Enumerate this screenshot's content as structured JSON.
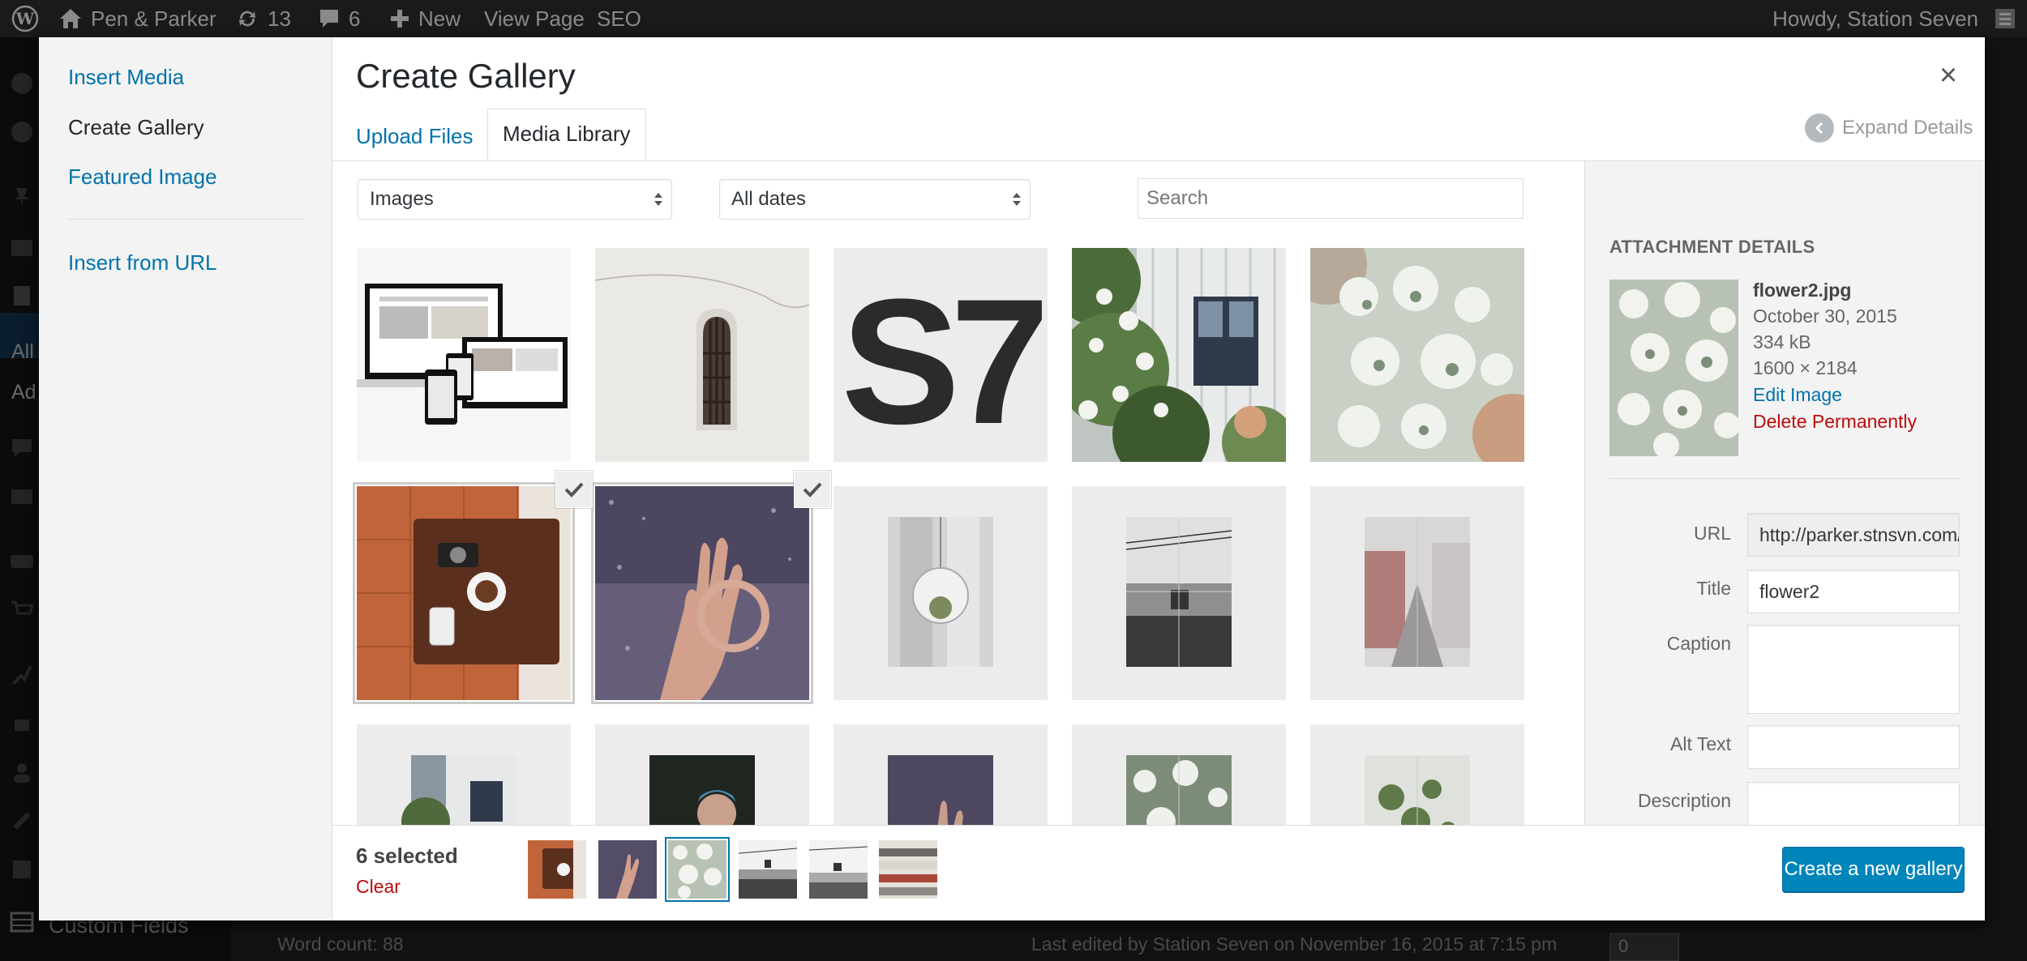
{
  "admin_bar": {
    "site_name": "Pen & Parker",
    "updates_count": "13",
    "comments_count": "6",
    "new_label": "New",
    "view_page_label": "View Page",
    "seo_label": "SEO",
    "greeting": "Howdy, Station Seven"
  },
  "background": {
    "menu_all": "All",
    "menu_add": "Ad",
    "custom_fields": "Custom Fields",
    "word_count": "Word count: 88",
    "last_edited": "Last edited by Station Seven on November 16, 2015 at 7:15 pm",
    "field_value": "0"
  },
  "media_menu": {
    "items": [
      {
        "label": "Insert Media",
        "active": false
      },
      {
        "label": "Create Gallery",
        "active": true
      },
      {
        "label": "Featured Image",
        "active": false
      },
      {
        "label": "Insert from URL",
        "active": false
      }
    ]
  },
  "frame": {
    "title": "Create Gallery",
    "close_symbol": "×",
    "tabs": [
      {
        "label": "Upload Files",
        "active": false
      },
      {
        "label": "Media Library",
        "active": true
      }
    ],
    "expand_details": "Expand Details"
  },
  "filters": {
    "type_selected": "Images",
    "date_selected": "All dates",
    "search_placeholder": "Search"
  },
  "grid": {
    "items": [
      {
        "name": "devices-mockup",
        "selected": false
      },
      {
        "name": "arched-window",
        "selected": false
      },
      {
        "name": "s7-logo",
        "selected": false,
        "text": "S7"
      },
      {
        "name": "house-with-flowers",
        "selected": false
      },
      {
        "name": "white-flowers",
        "selected": false
      },
      {
        "name": "coffee-table",
        "selected": true
      },
      {
        "name": "hand-on-glass",
        "selected": true
      },
      {
        "name": "poster-terrarium",
        "selected": false
      },
      {
        "name": "poster-cable-car",
        "selected": false
      },
      {
        "name": "poster-street",
        "selected": false
      },
      {
        "name": "poster-house",
        "selected": false
      },
      {
        "name": "poster-portrait",
        "selected": false
      },
      {
        "name": "poster-hand",
        "selected": false
      },
      {
        "name": "poster-flowers",
        "selected": false
      },
      {
        "name": "poster-plants",
        "selected": false
      }
    ]
  },
  "attachment_details": {
    "heading": "ATTACHMENT DETAILS",
    "filename": "flower2.jpg",
    "date": "October 30, 2015",
    "filesize": "334 kB",
    "dimensions": "1600 × 2184",
    "edit_link": "Edit Image",
    "delete_link": "Delete Permanently",
    "fields": {
      "url_label": "URL",
      "url_value": "http://parker.stnsvn.com/wp",
      "title_label": "Title",
      "title_value": "flower2",
      "caption_label": "Caption",
      "caption_value": "",
      "alt_label": "Alt Text",
      "alt_value": "",
      "description_label": "Description",
      "description_value": ""
    }
  },
  "selection": {
    "count_label": "6 selected",
    "clear_label": "Clear",
    "thumbs": [
      "coffee-table",
      "hand-on-glass",
      "white-flowers",
      "cable-car-1",
      "cable-car-2",
      "wood-planks"
    ]
  },
  "primary_button": "Create a new gallery",
  "colors": {
    "link": "#0073aa",
    "danger": "#bc0b0b",
    "button": "#0085ba",
    "admin_bar": "#1a1a1a"
  }
}
